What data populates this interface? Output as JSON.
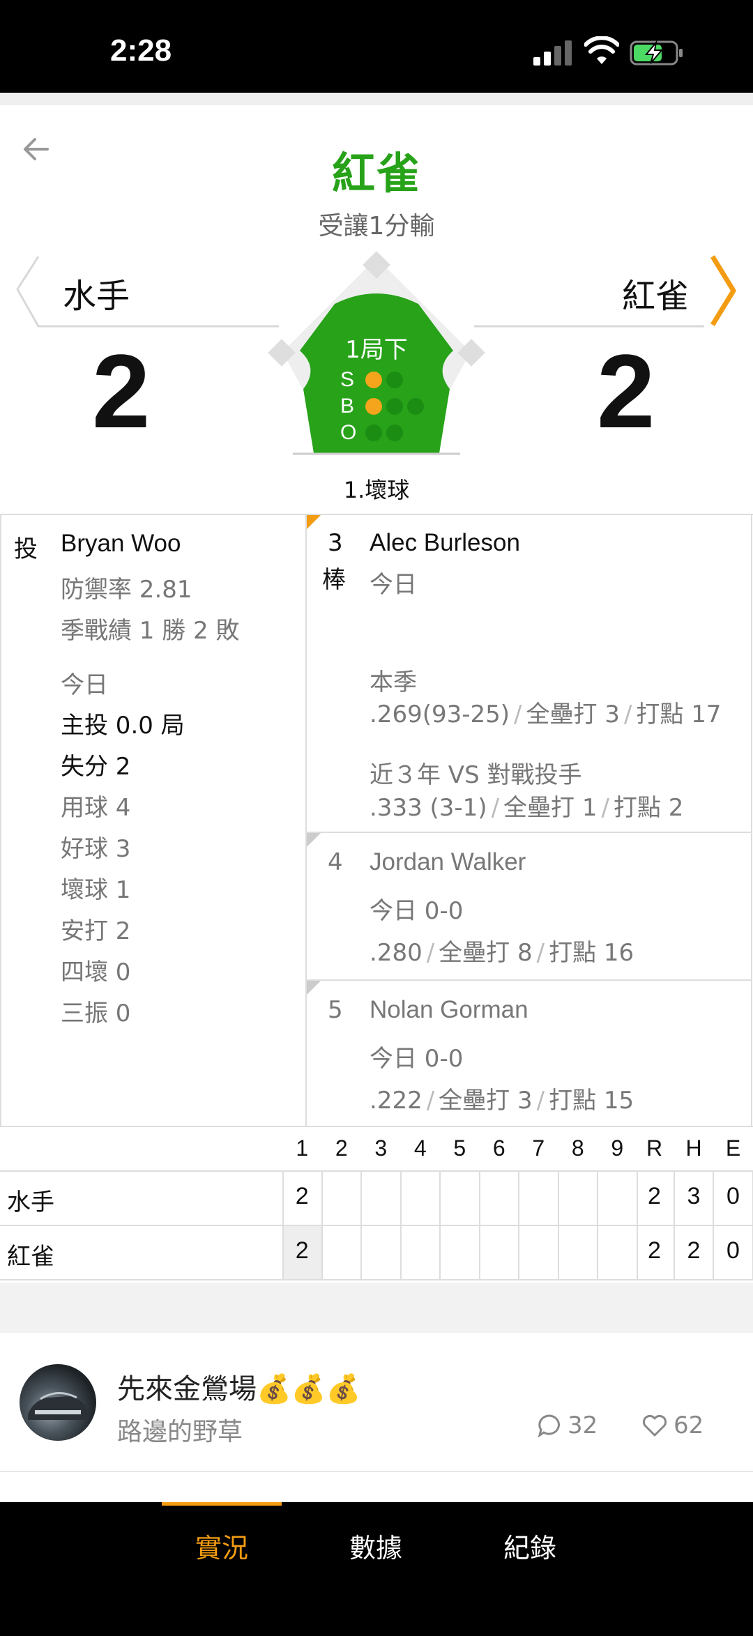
{
  "status": {
    "time": "2:28"
  },
  "header": {
    "title": "紅雀",
    "result": "受讓1分輸"
  },
  "teams": {
    "away": {
      "name": "水手",
      "score": "2"
    },
    "home": {
      "name": "紅雀",
      "score": "2"
    }
  },
  "situation": {
    "inning": "1局下",
    "strikes_label": "S",
    "balls_label": "B",
    "outs_label": "O",
    "strikes": 1,
    "balls": 1,
    "outs": 0,
    "last_play": "1.壞球"
  },
  "pitcher": {
    "label": "投",
    "name": "Bryan Woo",
    "era": "防禦率 2.81",
    "record": "季戰績 1 勝 2 敗",
    "today_label": "今日",
    "stats": [
      {
        "text": "主投 0.0 局",
        "dark": true
      },
      {
        "text": "失分 2",
        "dark": true
      },
      {
        "text": "用球 4",
        "dark": false
      },
      {
        "text": "好球 3",
        "dark": false
      },
      {
        "text": "壞球 1",
        "dark": false
      },
      {
        "text": "安打 2",
        "dark": false
      },
      {
        "text": "四壞 0",
        "dark": false
      },
      {
        "text": "三振 0",
        "dark": false
      }
    ]
  },
  "batters": {
    "current": {
      "order": "3",
      "order_suffix": "棒",
      "name": "Alec Burleson",
      "today_label": "今日",
      "season_label": "本季",
      "season_avg": ".269(93-25)",
      "season_hr": "全壘打 3",
      "season_rbi": "打點 17",
      "vs_label": "近３年 VS 對戰投手",
      "vs_avg": ".333 (3-1)",
      "vs_hr": "全壘打 1",
      "vs_rbi": "打點 2"
    },
    "next": [
      {
        "order": "4",
        "name": "Jordan Walker",
        "today": "今日 0-0",
        "avg": ".280",
        "hr": "全壘打 8",
        "rbi": "打點 16"
      },
      {
        "order": "5",
        "name": "Nolan Gorman",
        "today": "今日 0-0",
        "avg": ".222",
        "hr": "全壘打 3",
        "rbi": "打點 15"
      }
    ]
  },
  "linescore": {
    "headers": [
      "1",
      "2",
      "3",
      "4",
      "5",
      "6",
      "7",
      "8",
      "9",
      "R",
      "H",
      "E"
    ],
    "rows": [
      {
        "team": "水手",
        "innings": [
          "2",
          "",
          "",
          "",
          "",
          "",
          "",
          "",
          ""
        ],
        "R": "2",
        "H": "3",
        "E": "0"
      },
      {
        "team": "紅雀",
        "innings": [
          "2",
          "",
          "",
          "",
          "",
          "",
          "",
          "",
          ""
        ],
        "R": "2",
        "H": "2",
        "E": "0"
      }
    ]
  },
  "post": {
    "title": "先來金鶯場💰💰💰",
    "author": "路邊的野草",
    "comments": "32",
    "likes": "62"
  },
  "nav": {
    "items": [
      "實況",
      "數據",
      "紀錄"
    ],
    "active": 0
  },
  "colors": {
    "accent": "#f39c12",
    "team_green": "#27a219",
    "field_green": "#27a219"
  }
}
